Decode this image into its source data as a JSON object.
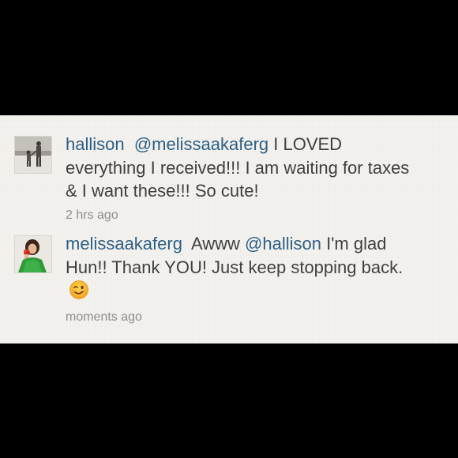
{
  "comments": [
    {
      "username": "hallison",
      "mention": "@melissaakaferg",
      "text": "I LOVED everything I received!!! I am waiting for taxes & I want these!!! So cute!",
      "time": "2 hrs ago",
      "avatar_icon": "beach-walk-photo-avatar"
    },
    {
      "username": "melissaakaferg",
      "text_before": "Awww",
      "mention": "@hallison",
      "text_after": "I'm glad Hun!! Thank YOU! Just keep stopping back.",
      "emoji_icon": "winking-face-icon",
      "time": "moments ago",
      "avatar_icon": "woman-green-dress-photo-avatar"
    }
  ],
  "colors": {
    "background": "#000000",
    "panel": "#f4f2ee",
    "link": "#2c5f86",
    "text": "#3f3f3f",
    "timestamp": "#8e8e8e"
  }
}
